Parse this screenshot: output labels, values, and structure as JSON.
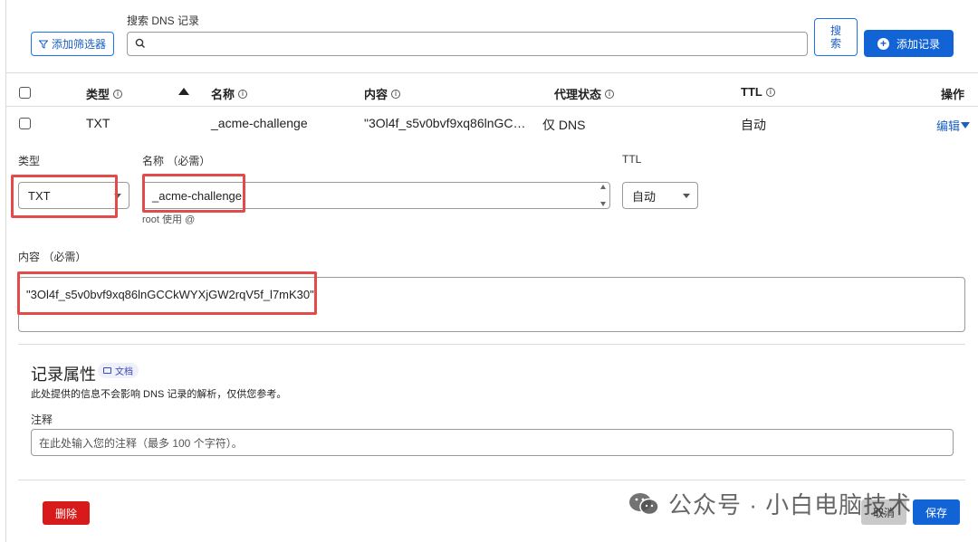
{
  "search": {
    "filter_label": "添加筛选器",
    "label": "搜索 DNS 记录",
    "value": "",
    "button_label": "搜索",
    "add_record_label": "添加记录"
  },
  "table": {
    "headers": {
      "type": "类型",
      "name": "名称",
      "content": "内容",
      "proxy": "代理状态",
      "ttl": "TTL",
      "actions": "操作"
    },
    "row": {
      "type": "TXT",
      "name": "_acme-challenge",
      "content": "\"3Ol4f_s5v0bvf9xq86lnGC…",
      "proxy": "仅 DNS",
      "ttl": "自动",
      "action": "编辑"
    }
  },
  "form": {
    "type_label": "类型",
    "type_value": "TXT",
    "name_label": "名称 （必需）",
    "name_value": "_acme-challenge",
    "name_hint": "root 使用 @",
    "ttl_label": "TTL",
    "ttl_value": "自动",
    "content_label": "内容 （必需）",
    "content_value": "\"3Ol4f_s5v0bvf9xq86lnGCCkWYXjGW2rqV5f_l7mK30\""
  },
  "attributes": {
    "title": "记录属性",
    "doc_badge": "文档",
    "description": "此处提供的信息不会影响 DNS 记录的解析，仅供您参考。",
    "note_label": "注释",
    "note_placeholder": "在此处输入您的注释（最多 100 个字符）。"
  },
  "footer": {
    "delete_label": "删除",
    "cancel_label": "取消",
    "save_label": "保存"
  },
  "watermark": {
    "text": "公众号 · 小白电脑技术"
  },
  "colors": {
    "primary": "#1264d6",
    "danger": "#d71a1a",
    "highlight": "#e34a4a"
  }
}
